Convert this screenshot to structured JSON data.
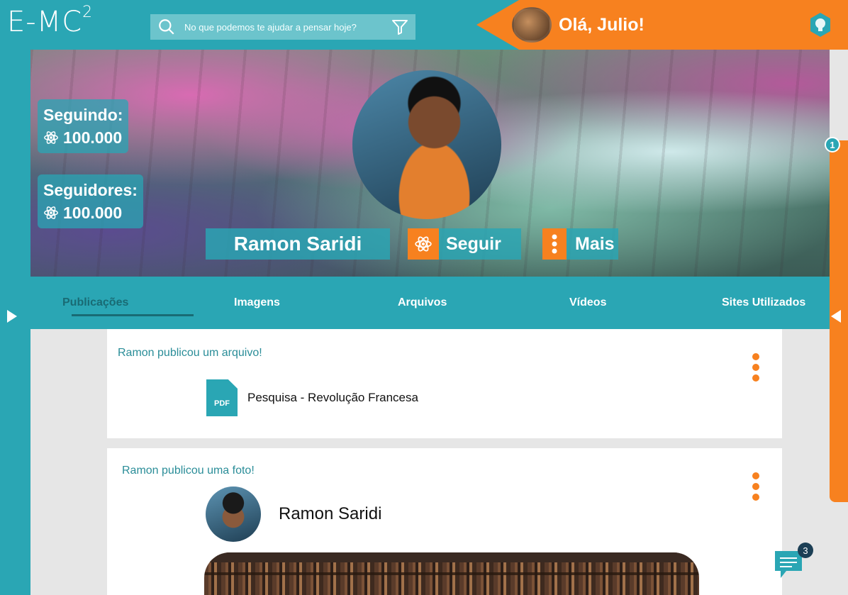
{
  "app": {
    "logo": "E-MC",
    "logo_sup": "2"
  },
  "search": {
    "placeholder": "No que podemos te ajudar a pensar hoje?"
  },
  "user": {
    "greeting": "Olá, Julio!"
  },
  "profile": {
    "name": "Ramon Saridi",
    "following_label": "Seguindo:",
    "following_count": "100.000",
    "followers_label": "Seguidores:",
    "followers_count": "100.000",
    "follow_label": "Seguir",
    "more_label": "Mais"
  },
  "tabs": [
    {
      "label": "Publicações",
      "active": true
    },
    {
      "label": "Imagens"
    },
    {
      "label": "Arquivos"
    },
    {
      "label": "Vídeos"
    },
    {
      "label": "Sites Utilizados"
    }
  ],
  "feed": [
    {
      "title": "Ramon publicou um arquivo!",
      "file_type": "PDF",
      "file_name": "Pesquisa - Revolução Francesa"
    },
    {
      "title": "Ramon publicou uma foto!",
      "author": "Ramon Saridi"
    }
  ],
  "right_panel": {
    "badge": "1"
  },
  "chat": {
    "badge": "3"
  },
  "colors": {
    "primary": "#2aa6b4",
    "accent": "#f7811f",
    "dark_teal": "#196b74"
  }
}
